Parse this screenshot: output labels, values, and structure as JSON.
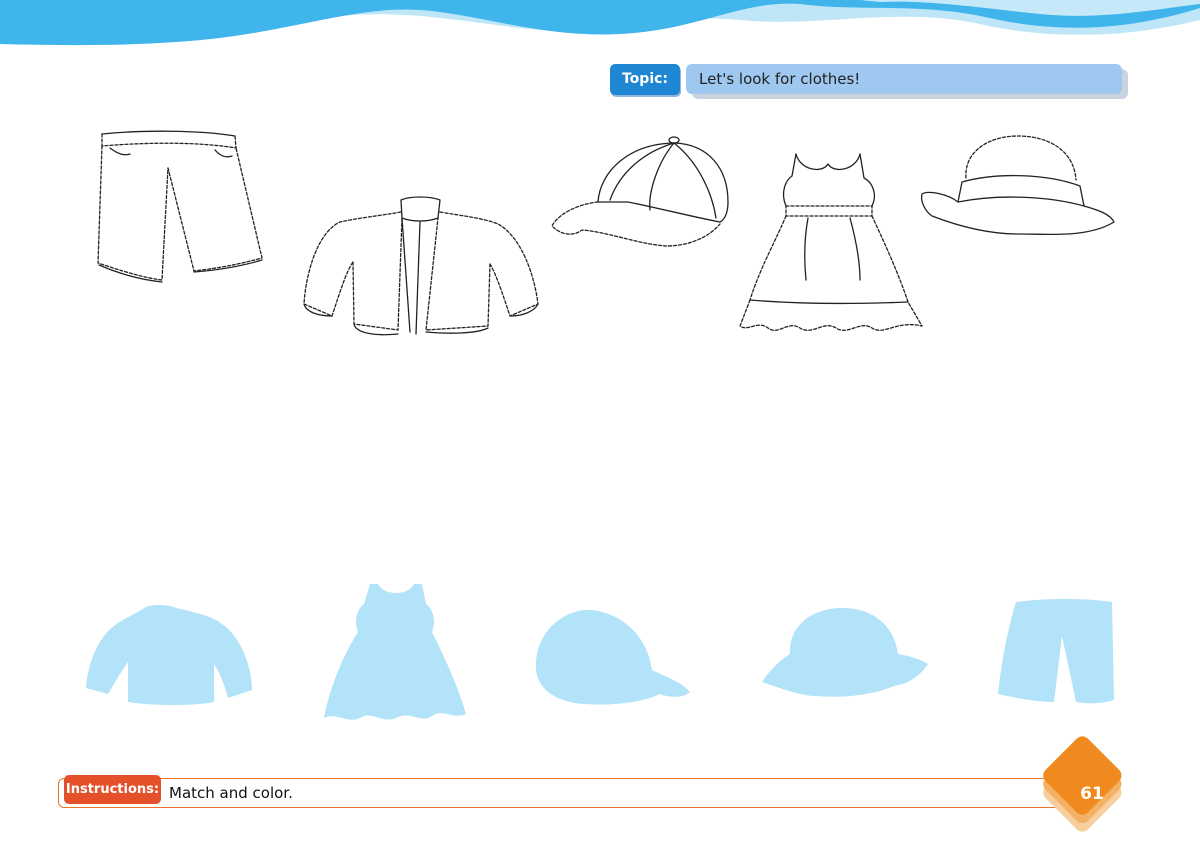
{
  "header": {
    "topic_label": "Topic:",
    "topic_text": "Let's look for clothes!"
  },
  "outline_items": [
    {
      "icon": "shorts-icon"
    },
    {
      "icon": "jacket-icon"
    },
    {
      "icon": "cap-icon"
    },
    {
      "icon": "dress-icon"
    },
    {
      "icon": "bucket-hat-icon"
    }
  ],
  "silhouette_items": [
    {
      "icon": "jacket-silhouette-icon"
    },
    {
      "icon": "dress-silhouette-icon"
    },
    {
      "icon": "cap-silhouette-icon"
    },
    {
      "icon": "bucket-hat-silhouette-icon"
    },
    {
      "icon": "shorts-silhouette-icon"
    }
  ],
  "footer": {
    "instructions_label": "Instructions:",
    "instructions_text": "Match and color.",
    "page_number": "61"
  },
  "colors": {
    "wave_dark": "#3fb5ec",
    "wave_light": "#bfe6f7",
    "topic_label_bg": "#1f86d4",
    "topic_bar_bg": "#9ec8ef",
    "silhouette_fill": "#b2e3f8",
    "instructions_label_bg": "#e4502a",
    "page_badge": "#f08a1e"
  }
}
